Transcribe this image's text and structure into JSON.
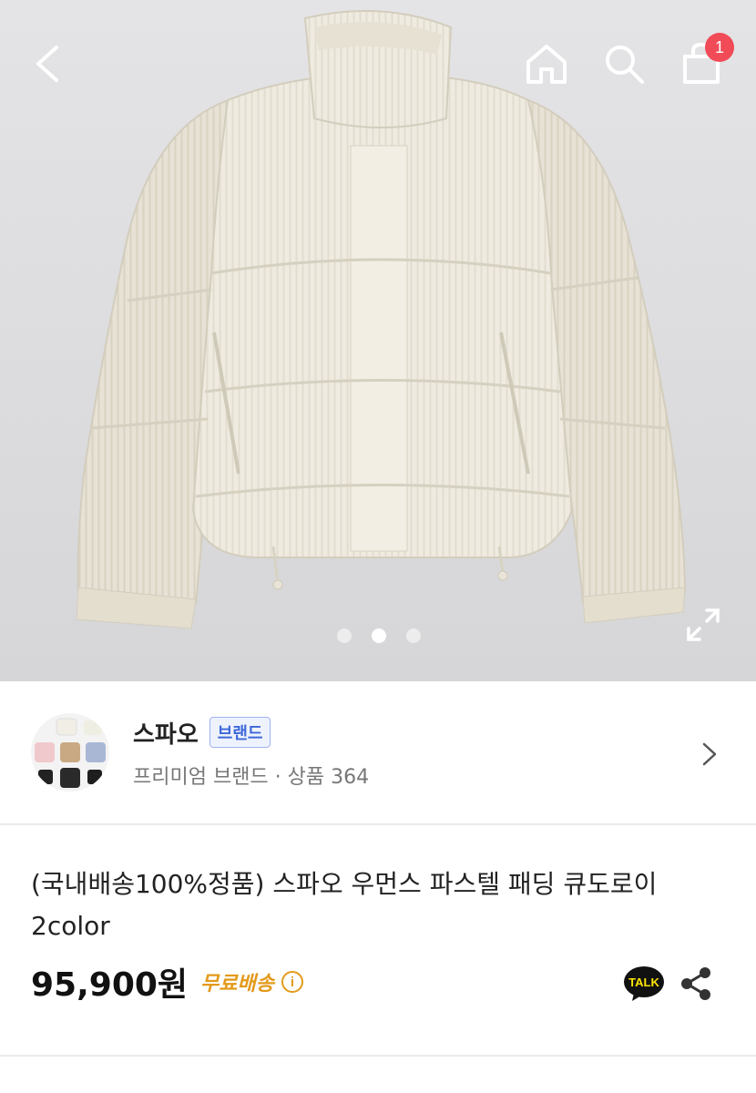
{
  "header": {
    "cart_count": "1",
    "icons": [
      "back-arrow-icon",
      "home-icon",
      "search-icon",
      "shopping-bag-icon"
    ]
  },
  "gallery": {
    "slide_count": 3,
    "active_index": 1
  },
  "brand": {
    "name": "스파오",
    "tag": "브랜드",
    "subtitle": "프리미엄 브랜드 · 상품 364"
  },
  "product": {
    "title": "(국내배송100%정품) 스파오 우먼스 파스텔 패딩 큐도로이 2color",
    "price": "95,900원",
    "shipping": "무료배송",
    "info_icon_label": "i",
    "talk_label": "TALK"
  },
  "colors": {
    "badge": "#f04b57",
    "brand_tag": "#3d68d8",
    "shipping": "#e39a1b",
    "talk_yellow": "#fee500"
  }
}
